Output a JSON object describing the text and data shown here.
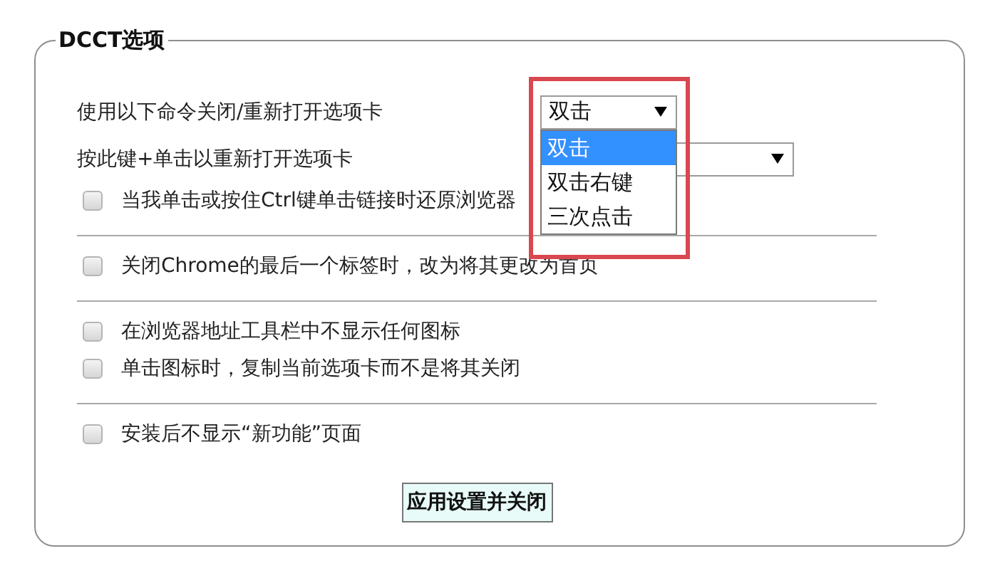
{
  "group": {
    "title": "DCCT选项"
  },
  "sections": [
    {
      "items": [
        {
          "kind": "select",
          "label": "使用以下命令关闭/重新打开选项卡",
          "value": "双击",
          "open": true,
          "highlighted": true,
          "options": [
            {
              "label": "双击",
              "selected": true
            },
            {
              "label": "双击右键",
              "selected": false
            },
            {
              "label": "三次点击",
              "selected": false
            }
          ]
        },
        {
          "kind": "select",
          "label": "按此键+单击以重新打开选项卡",
          "open": false
        },
        {
          "kind": "checkbox",
          "label": "当我单击或按住Ctrl键单击链接时还原浏览器",
          "checked": false
        }
      ]
    },
    {
      "items": [
        {
          "kind": "checkbox",
          "label": "关闭Chrome的最后一个标签时，改为将其更改为首页",
          "checked": false
        }
      ]
    },
    {
      "items": [
        {
          "kind": "checkbox",
          "label": "在浏览器地址工具栏中不显示任何图标",
          "checked": false
        },
        {
          "kind": "checkbox",
          "label": "单击图标时，复制当前选项卡而不是将其关闭",
          "checked": false
        }
      ]
    },
    {
      "items": [
        {
          "kind": "checkbox",
          "label": "安装后不显示“新功能”页面",
          "checked": false
        }
      ]
    }
  ],
  "button": {
    "label": "应用设置并关闭"
  }
}
